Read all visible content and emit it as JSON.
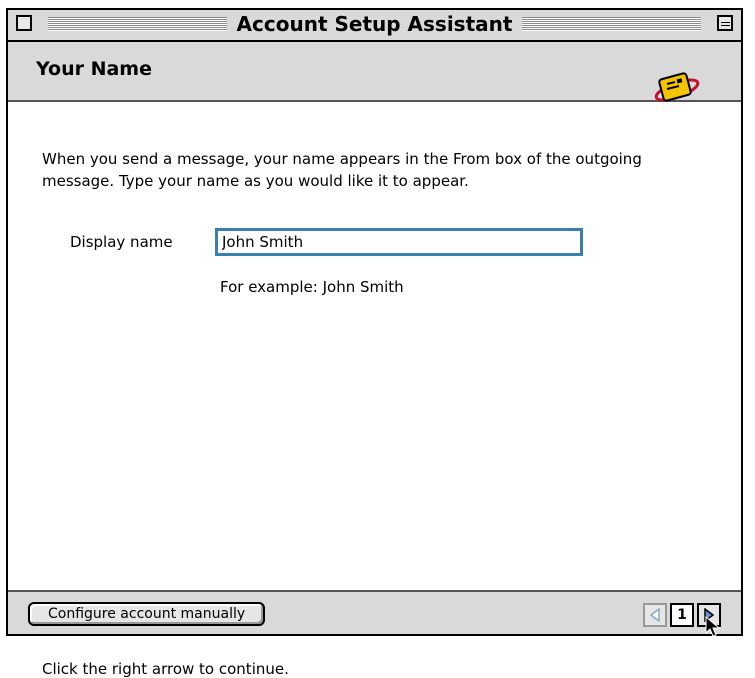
{
  "window": {
    "title": "Account Setup Assistant"
  },
  "header": {
    "heading": "Your Name",
    "logo_icon": "mail-envelope-icon"
  },
  "content": {
    "intro": "When you send a message, your name appears in the From box of the outgoing message. Type your name as you would like it to appear.",
    "display_name_label": "Display name",
    "display_name_value": "John Smith",
    "example": "For example: John Smith",
    "continue_hint": "Click the right arrow to continue."
  },
  "footer": {
    "manual_button": "Configure account manually",
    "page_number": "1",
    "prev_icon": "left-arrow-icon",
    "next_icon": "right-arrow-icon"
  },
  "colors": {
    "accent": "#3a7fb0",
    "chrome": "#d9d9d9",
    "logo_yellow": "#f5c400",
    "logo_red": "#c8102e"
  }
}
